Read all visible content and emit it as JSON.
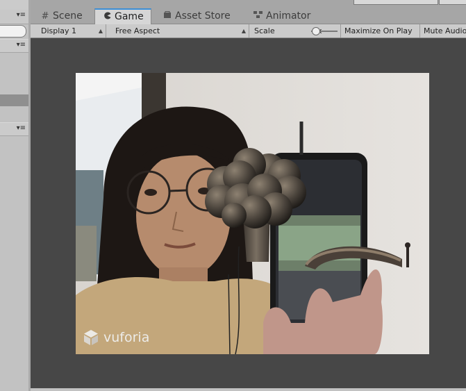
{
  "tabs": [
    {
      "label": "Scene",
      "icon": "hash-icon",
      "active": false
    },
    {
      "label": "Game",
      "icon": "pacman-icon",
      "active": true
    },
    {
      "label": "Asset Store",
      "icon": "bag-icon",
      "active": false
    },
    {
      "label": "Animator",
      "icon": "animator-icon",
      "active": false
    }
  ],
  "toolbar": {
    "display": "Display 1",
    "aspect": "Free Aspect",
    "scale_label": "Scale",
    "scale_value": "1x",
    "maximize_on_play": "Maximize On Play",
    "mute_audio": "Mute Audio"
  },
  "game_view": {
    "watermark": "vuforia",
    "scene_objects": [
      "tree-model",
      "arch-model"
    ]
  }
}
